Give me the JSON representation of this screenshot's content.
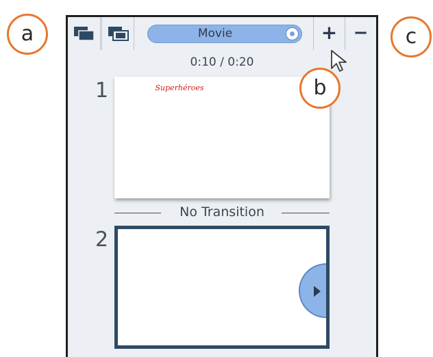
{
  "toolbar": {
    "view_buttons": [
      {
        "icon": "slides-stack-icon"
      },
      {
        "icon": "slides-grid-icon"
      }
    ],
    "movie_label": "Movie",
    "zoom_in_label": "+",
    "zoom_out_label": "−"
  },
  "timecode": "0:10 / 0:20",
  "slides": [
    {
      "number": "1",
      "title": "Superhéroes"
    },
    {
      "number": "2",
      "title": ""
    }
  ],
  "transition": {
    "label": "No Transition"
  },
  "annotations": {
    "a": "a",
    "b": "b",
    "c": "c"
  },
  "colors": {
    "panel_bg": "#eceff3",
    "accent_blue": "#8db4e8",
    "callout_orange": "#e8762c",
    "slide_title_red": "#d21b1b",
    "selected_border": "#2e4a63"
  }
}
